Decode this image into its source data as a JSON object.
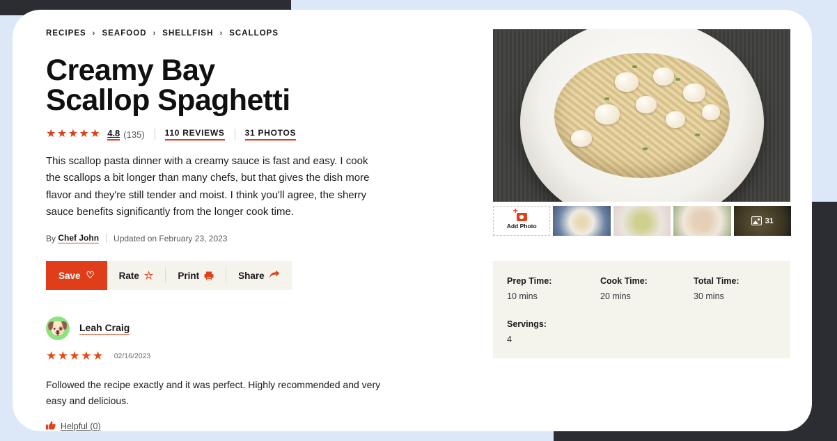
{
  "breadcrumb": [
    {
      "label": "RECIPES"
    },
    {
      "label": "SEAFOOD"
    },
    {
      "label": "SHELLFISH"
    },
    {
      "label": "SCALLOPS"
    }
  ],
  "breadcrumb_separator": "›",
  "recipe": {
    "title": "Creamy Bay Scallop Spaghetti",
    "stars": "★★★★★",
    "rating": "4.8",
    "rating_count": "(135)",
    "reviews_link": "110 REVIEWS",
    "photos_link": "31 PHOTOS",
    "description": "This scallop pasta dinner with a creamy sauce is fast and easy. I cook the scallops a bit longer than many chefs, but that gives the dish more flavor and they're still tender and moist. I think you'll agree, the sherry sauce benefits significantly from the longer cook time.",
    "by_prefix": "By",
    "author": "Chef John",
    "updated": "Updated on February 23, 2023"
  },
  "actions": {
    "save": {
      "label": "Save",
      "icon": "heart-icon",
      "glyph": "♡"
    },
    "rate": {
      "label": "Rate",
      "icon": "star-outline-icon",
      "glyph": "☆"
    },
    "print": {
      "label": "Print",
      "icon": "printer-icon",
      "glyph": "⎙"
    },
    "share": {
      "label": "Share",
      "icon": "share-arrow-icon",
      "glyph": "➦"
    }
  },
  "colors": {
    "accent": "#e03e1a",
    "star": "#d8421c",
    "review_star": "#e8490f",
    "cream": "#f4f4ec",
    "dark_band": "#2b2d33",
    "blue_band": "#dce7f7"
  },
  "gallery": {
    "add_photo": {
      "label": "Add Photo",
      "icon": "camera-plus-icon"
    },
    "thumbnails": [
      {
        "name": "recipe-photo-1"
      },
      {
        "name": "recipe-photo-2"
      },
      {
        "name": "recipe-photo-3"
      },
      {
        "name": "recipe-photo-4"
      }
    ],
    "more_count": "31",
    "more_icon": "photo-stack-icon"
  },
  "meta": {
    "prep_label": "Prep Time:",
    "prep_value": "10 mins",
    "cook_label": "Cook Time:",
    "cook_value": "20 mins",
    "total_label": "Total Time:",
    "total_value": "30 mins",
    "servings_label": "Servings:",
    "servings_value": "4"
  },
  "review": {
    "avatar_icon": "dog-avatar-icon",
    "avatar_glyph": "🐶",
    "reviewer": "Leah Craig",
    "stars": "★★★★★",
    "date": "02/16/2023",
    "text": "Followed the recipe exactly and it was perfect. Highly recommended and very easy and delicious.",
    "helpful_label": "Helpful (0)",
    "helpful_icon": "thumbs-up-icon",
    "helpful_glyph": "👍"
  }
}
